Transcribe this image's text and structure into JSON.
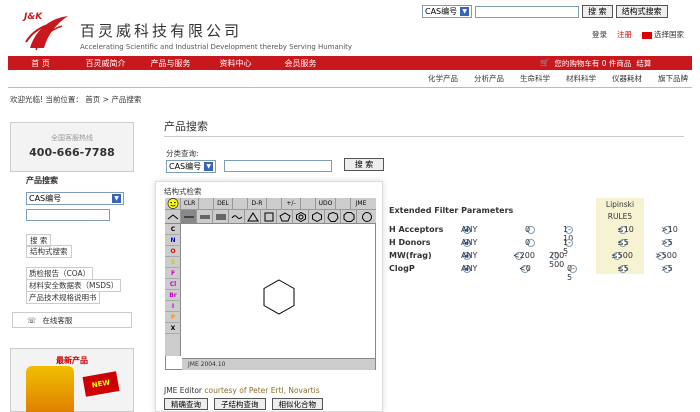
{
  "header": {
    "logo_text": "J&K",
    "brand_name": "百灵威科技有限公司",
    "tagline": "Accelerating Scientific and Industrial Development thereby Serving Humanity",
    "search_select": "CAS编号",
    "search_button": "搜 索",
    "structure_search_button": "结构式搜索",
    "links": {
      "login": "登录",
      "register": "注册",
      "country": "选择国家"
    }
  },
  "nav": {
    "items": [
      "首 页",
      "百灵威简介",
      "产品与服务",
      "资料中心",
      "会员服务"
    ],
    "cart_text": "您的购物车有 0 件商品",
    "checkout": "结算"
  },
  "sub_nav": [
    "化学产品",
    "分析产品",
    "生命科学",
    "材料科学",
    "仪器耗材",
    "旗下品牌"
  ],
  "breadcrumb": {
    "prefix": "欢迎光临! 当前位置：",
    "home": "首页",
    "current": "> 产品搜索"
  },
  "sidebar": {
    "hotline_label": "全国客服热线",
    "hotline_number": "400-666-7788",
    "search_title": "产品搜索",
    "search_select": "CAS编号",
    "search_btn": "搜 索",
    "structure_btn": "结构式搜索",
    "docs": [
      "质检报告（COA）",
      "材料安全数据表（MSDS）",
      "产品技术规格说明书"
    ],
    "online_service": "在线客服",
    "new_products_title": "最新产品",
    "badge": "NEW"
  },
  "main": {
    "page_title": "产品搜索",
    "category_label": "分类查询:",
    "category_select": "CAS编号",
    "category_button": "搜 索"
  },
  "filter": {
    "title": "Extended Filter Parameters",
    "lipinski": [
      "Lipinski",
      "RULE5"
    ],
    "rows": [
      {
        "name": "H Acceptors",
        "any": "ANY",
        "c1": "0",
        "c2": "1-10",
        "c3": "≤10",
        "c4": ">10"
      },
      {
        "name": "H Donors",
        "any": "ANY",
        "c1": "0",
        "c2": "1-5",
        "c3": "≤5",
        "c4": ">5"
      },
      {
        "name": "MW(frag)",
        "any": "ANY",
        "c1": "<200",
        "c2": "200-500",
        "c3": "≤500",
        "c4": ">500"
      },
      {
        "name": "ClogP",
        "any": "ANY",
        "c1": "<0",
        "c2": "0-5",
        "c3": "≤5",
        "c4": ">5"
      }
    ]
  },
  "modal": {
    "title": "结构式检索",
    "toolbar1": [
      "CLR",
      "",
      "DEL",
      "",
      "D-R",
      "",
      "+/-",
      "",
      "UDO",
      "",
      "JME"
    ],
    "elements": [
      "C",
      "N",
      "O",
      "S",
      "F",
      "Cl",
      "Br",
      "I",
      "P",
      "X"
    ],
    "status": "JME 2004.10",
    "credit_prefix": "JME Editor",
    "credit_suffix": "courtesy of Peter Ertl, Novartis",
    "buttons": [
      "精确查询",
      "子结构查询",
      "相似化合物"
    ]
  }
}
